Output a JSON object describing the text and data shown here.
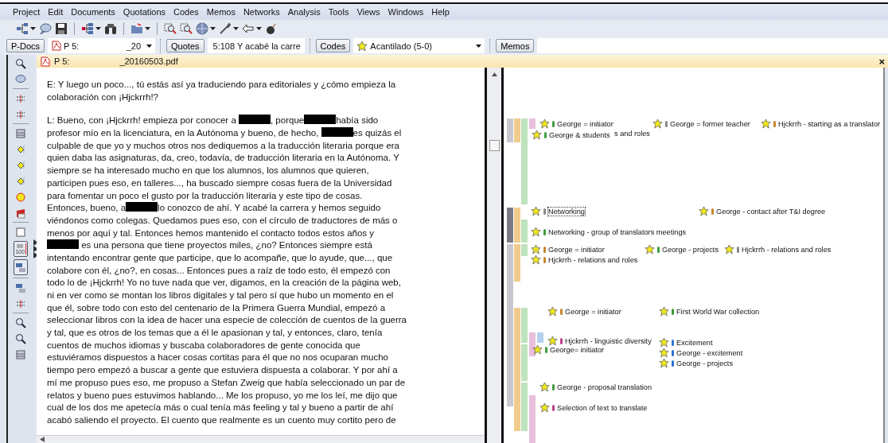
{
  "menu": [
    "Project",
    "Edit",
    "Documents",
    "Quotations",
    "Codes",
    "Memos",
    "Networks",
    "Analysis",
    "Tools",
    "Views",
    "Windows",
    "Help"
  ],
  "navigator": {
    "pdocs_button": "P-Docs",
    "pdoc_value": "P 5:",
    "pdoc_value_end": "_20",
    "quotes_button": "Quotes",
    "quote_value": "5:108 Y acabé la carre",
    "codes_button": "Codes",
    "code_value": "Acantilado (5-0)",
    "memos_button": "Memos"
  },
  "left_toolbar": [
    {
      "pressed": false
    },
    {
      "pressed": false
    },
    {
      "pressed": false
    },
    {
      "pressed": false
    },
    {
      "pressed": false
    },
    {
      "pressed": false
    },
    {
      "pressed": false
    },
    {
      "pressed": false
    },
    {
      "pressed": false
    },
    {
      "pressed": false
    },
    {
      "pressed": false
    },
    {
      "pressed": true,
      "label": "99 100"
    },
    {
      "pressed": true
    },
    {
      "pressed": false
    },
    {
      "pressed": false
    },
    {
      "pressed": false
    },
    {
      "pressed": false
    },
    {
      "pressed": false
    }
  ],
  "document_tab": {
    "title_start": "P 5:",
    "title_end": "_20160503.pdf",
    "close": "×"
  },
  "document": [
    {
      "lines": [
        [
          {
            "kind": "text",
            "text": "E: Y luego un poco..., tú estás así ya traduciendo para editoriales y ¿cómo empieza la"
          }
        ],
        [
          {
            "kind": "text",
            "text": "colaboración con ¡Hjckrrh!?"
          }
        ]
      ]
    },
    {
      "lines": [
        [
          {
            "kind": "text",
            "text": "L: Bueno, con ¡Hjckrrh! empieza por conocer a "
          },
          {
            "kind": "redacted"
          },
          {
            "kind": "text",
            "text": ", porque"
          },
          {
            "kind": "redacted"
          },
          {
            "kind": "text",
            "text": "había sido"
          }
        ],
        [
          {
            "kind": "text",
            "text": "profesor mío en la licenciatura, en la Autónoma y bueno, de hecho, "
          },
          {
            "kind": "redacted"
          },
          {
            "kind": "text",
            "text": "es quizás el"
          }
        ],
        [
          {
            "kind": "text",
            "text": "culpable de que yo y muchos otros nos dediquemos a la traducción literaria porque era"
          }
        ],
        [
          {
            "kind": "text",
            "text": "quien daba las asignaturas, da, creo, todavía, de traducción literaria en la Autónoma. Y"
          }
        ],
        [
          {
            "kind": "text",
            "text": "siempre se ha interesado mucho en que los alumnos, los alumnos que quieren,"
          }
        ],
        [
          {
            "kind": "text",
            "text": "participen pues eso, en talleres..., ha buscado siempre cosas fuera de la Universidad"
          }
        ],
        [
          {
            "kind": "text",
            "text": "para fomentar un poco el gusto por la traducción literaria y este tipo de cosas."
          }
        ],
        [
          {
            "kind": "text",
            "text": "Entonces, bueno, a"
          },
          {
            "kind": "redacted"
          },
          {
            "kind": "text",
            "text": "lo conozco de ahí. Y acabé la carrera y hemos seguido"
          }
        ],
        [
          {
            "kind": "text",
            "text": "viéndonos como colegas. Quedamos pues eso, con el círculo de traductores de más o"
          }
        ],
        [
          {
            "kind": "text",
            "text": "menos por aquí y tal. Entonces hemos mantenido el contacto todos estos años y"
          }
        ],
        [
          {
            "kind": "redacted"
          },
          {
            "kind": "text",
            "text": " es una persona que tiene proyectos miles, ¿no? Entonces siempre está"
          }
        ],
        [
          {
            "kind": "text",
            "text": "intentando encontrar gente que participe, que lo acompañe, que lo ayude, que..., que"
          }
        ],
        [
          {
            "kind": "text",
            "text": "colabore con él, ¿no?, en cosas... Entonces pues a raíz de todo esto, él empezó con"
          }
        ],
        [
          {
            "kind": "text",
            "text": "todo lo de ¡Hjckrrh! Yo no tuve nada que ver, digamos, en la creación de la página web,"
          }
        ],
        [
          {
            "kind": "text",
            "text": "ni en ver como se montan los libros digitales y tal pero sí que hubo un momento en el"
          }
        ],
        [
          {
            "kind": "text",
            "text": "que él, sobre todo con esto del centenario de la Primera Guerra Mundial, empezó a"
          }
        ],
        [
          {
            "kind": "text",
            "text": "seleccionar libros con la idea de hacer una especie de colección de cuentos de la guerra"
          }
        ],
        [
          {
            "kind": "text",
            "text": "y tal, que es otros de los temas que a él le apasionan y tal, y entonces, claro, tenía"
          }
        ],
        [
          {
            "kind": "text",
            "text": "cuentos de muchos idiomas y buscaba colaboradores de gente conocida que"
          }
        ],
        [
          {
            "kind": "text",
            "text": "estuviéramos dispuestos a hacer cosas cortitas para él que no nos ocuparan mucho"
          }
        ],
        [
          {
            "kind": "text",
            "text": "tiempo pero empezó a buscar a gente que estuviera dispuesta a colaborar. Y por ahí a"
          }
        ],
        [
          {
            "kind": "text",
            "text": "mí me propuso pues eso, me propuso a Stefan Zweig que había seleccionado un par de"
          }
        ],
        [
          {
            "kind": "text",
            "text": "relatos y bueno pues estuvimos hablando... Me los propuso, yo me los leí, me dijo que"
          }
        ],
        [
          {
            "kind": "text",
            "text": "cual de los dos me apetecía más o cual tenía más feeling y tal y bueno a partir de ahí"
          }
        ],
        [
          {
            "kind": "text",
            "text": "acabó saliendo el proyecto. El cuento que realmente es un cuento muy cortito pero de"
          }
        ]
      ]
    }
  ],
  "margin_bars": [
    {
      "color": "#c8c8d0"
    },
    {
      "color": "#f0cc8c"
    },
    {
      "color": "#bfe3bd"
    },
    {
      "color": "#e8bfdc"
    },
    {
      "color": "#7a7a86"
    },
    {
      "color": "#f0cc8c"
    },
    {
      "color": "#bfe3bd"
    },
    {
      "color": "#c8c8d0"
    },
    {
      "color": "#f0cc8c"
    },
    {
      "color": "#bfe3bd"
    },
    {
      "color": "#f0cc8c"
    },
    {
      "color": "#bfe3bd"
    },
    {
      "color": "#bfe3bd"
    },
    {
      "color": "#bfe3bd"
    },
    {
      "color": "#e8bfdc"
    },
    {
      "color": "#e8bfdc"
    },
    {
      "color": "#b3d0ee"
    }
  ],
  "margin_codes": [
    {
      "kind": "code",
      "label": "George = initiator",
      "color": "#3f9c3f",
      "selected": false
    },
    {
      "kind": "code",
      "label": "George = former teacher",
      "color": "#8a8a8a",
      "selected": false
    },
    {
      "kind": "code",
      "label": "Hjckrrh - starting as a translator",
      "color": "#c8862a",
      "selected": false
    },
    {
      "kind": "code",
      "label": "George & students",
      "color": "#3f9c3f",
      "selected": false
    },
    {
      "kind": "fragment",
      "label": "s and roles"
    },
    {
      "kind": "code",
      "label": "Networking",
      "color": "#8a8a8a",
      "selected": true
    },
    {
      "kind": "code",
      "label": "George - contact after T&I degree",
      "color": "#c8862a",
      "selected": false
    },
    {
      "kind": "code",
      "label": "Networking - group of translators meetings",
      "color": "#3f9c3f",
      "selected": false
    },
    {
      "kind": "code",
      "label": "George = initiator",
      "color": "#c8862a",
      "selected": false
    },
    {
      "kind": "code",
      "label": "George - projects",
      "color": "#3f9c3f",
      "selected": false
    },
    {
      "kind": "code",
      "label": "Hjckrrh - relations and roles",
      "color": "#8a8a8a",
      "selected": false
    },
    {
      "kind": "code",
      "label": "Hjckrrh - relations and roles",
      "color": "#c8862a",
      "selected": false
    },
    {
      "kind": "code",
      "label": "George = initiator",
      "color": "#c8862a",
      "selected": false
    },
    {
      "kind": "code",
      "label": "First World War collection",
      "color": "#3f9c3f",
      "selected": false
    },
    {
      "kind": "code",
      "label": "Hjckrrh - linguistic diversity",
      "color": "#c0408e",
      "selected": false
    },
    {
      "kind": "code",
      "label": "George= initiator",
      "color": "#3f9c3f",
      "selected": false
    },
    {
      "kind": "code",
      "label": "Excitement",
      "color": "#2f74d0",
      "selected": false
    },
    {
      "kind": "code",
      "label": "George - excitement",
      "color": "#2f74d0",
      "selected": false
    },
    {
      "kind": "code",
      "label": "George - projects",
      "color": "#2f74d0",
      "selected": false
    },
    {
      "kind": "code",
      "label": "George - proposal translation",
      "color": "#3f9c3f",
      "selected": false
    },
    {
      "kind": "code",
      "label": "Selection of text to translate",
      "color": "#c0408e",
      "selected": false
    }
  ]
}
